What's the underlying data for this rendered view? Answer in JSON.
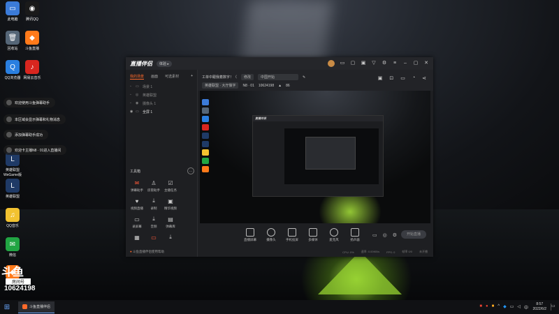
{
  "desktop_icons": [
    {
      "label": "此电脑",
      "color": "#3b7bd8",
      "glyph": "▭"
    },
    {
      "label": "腾讯QQ",
      "color": "#1a1a1a",
      "glyph": "◉"
    },
    {
      "label": "回收站",
      "color": "#556677",
      "glyph": "🗑"
    },
    {
      "label": "斗鱼直播",
      "color": "#ff7a1a",
      "glyph": "◆"
    },
    {
      "label": "QQ浏览器",
      "color": "#2a7fe0",
      "glyph": "Q"
    },
    {
      "label": "网易云音乐",
      "color": "#d8261f",
      "glyph": "♪"
    },
    {
      "label": "英雄联盟 WeGame版",
      "color": "#1f3a66",
      "glyph": "L"
    },
    {
      "label": "英雄联盟",
      "color": "#1f3a66",
      "glyph": "L"
    },
    {
      "label": "QQ音乐",
      "color": "#f2c230",
      "glyph": "♫"
    },
    {
      "label": "微信",
      "color": "#21a543",
      "glyph": "✉"
    },
    {
      "label": "斗鱼直播",
      "color": "#ff7a1a",
      "glyph": "◆"
    }
  ],
  "notifications": [
    "欢迎使用斗鱼弹幕助手",
    "本区域会显示弹幕和礼物消息",
    "添加弹幕助手成功",
    "欢迎卡主播N8 · 01进入直播间"
  ],
  "room": {
    "logo": "斗鱼",
    "label": "房间号",
    "number": "10624198"
  },
  "app": {
    "logo": "直播伴侣",
    "badge": "体验 ▸",
    "left_tabs": [
      "我的场景",
      "画面",
      "可选素材"
    ],
    "add_label": "+",
    "scenes": [
      "场景 1",
      "英雄联盟",
      "摄像头 1",
      "全屏 1"
    ],
    "tools_title": "工具箱",
    "tools": [
      {
        "label": "弹幕助手",
        "icon": "danmu-icon",
        "glyph": "✉",
        "hot": true
      },
      {
        "label": "房管助手",
        "icon": "user-icon",
        "glyph": "♙",
        "hot": false
      },
      {
        "label": "主播任务",
        "icon": "task-icon",
        "glyph": "☑",
        "hot": false
      },
      {
        "label": "",
        "icon": "blank",
        "glyph": "",
        "hot": false
      },
      {
        "label": "视频直播",
        "icon": "video-icon",
        "glyph": "♥",
        "hot": false
      },
      {
        "label": "录制",
        "icon": "download-icon",
        "glyph": "⤓",
        "hot": false
      },
      {
        "label": "精华视频",
        "icon": "video-clip-icon",
        "glyph": "▣",
        "hot": false
      },
      {
        "label": "",
        "icon": "blank",
        "glyph": "",
        "hot": false
      },
      {
        "label": "录屏幕",
        "icon": "record-icon",
        "glyph": "▭",
        "hot": false
      },
      {
        "label": "音频",
        "icon": "audio-icon",
        "glyph": "⤓",
        "hot": false
      },
      {
        "label": "弹幕库",
        "icon": "library-icon",
        "glyph": "▤",
        "hot": false
      },
      {
        "label": "",
        "icon": "blank",
        "glyph": "",
        "hot": false
      },
      {
        "label": "",
        "icon": "more-icon",
        "glyph": "▦",
        "hot": false
      },
      {
        "label": "",
        "icon": "new-icon",
        "glyph": "▭",
        "hot": true
      },
      {
        "label": "",
        "icon": "download-icon",
        "glyph": "⤓",
        "hot": false
      }
    ],
    "left_footer": "斗鱼直播伴侣使用帮助",
    "stream_title": "工单中跟我着数字！（",
    "title_chip": "修改",
    "category_chip": "中国开始",
    "category_line": "英雄联盟 · 大厅做字",
    "room_line": "N8 · 01",
    "room_id": "10624198",
    "viewers": "86",
    "controls": [
      "直播屏幕",
      "摄像头",
      "手机投屏",
      "多媒体",
      "麦克风",
      "扬声器"
    ],
    "start_btn": "开始直播",
    "status": [
      "CPU: 0%",
      "速率: 0.00KB/s",
      "FPS: 0",
      "帧率 0/0",
      "未开播"
    ]
  },
  "taskbar": {
    "app_label": "斗鱼直播伴侣",
    "time": "8:57",
    "date": "2022/6/2"
  }
}
